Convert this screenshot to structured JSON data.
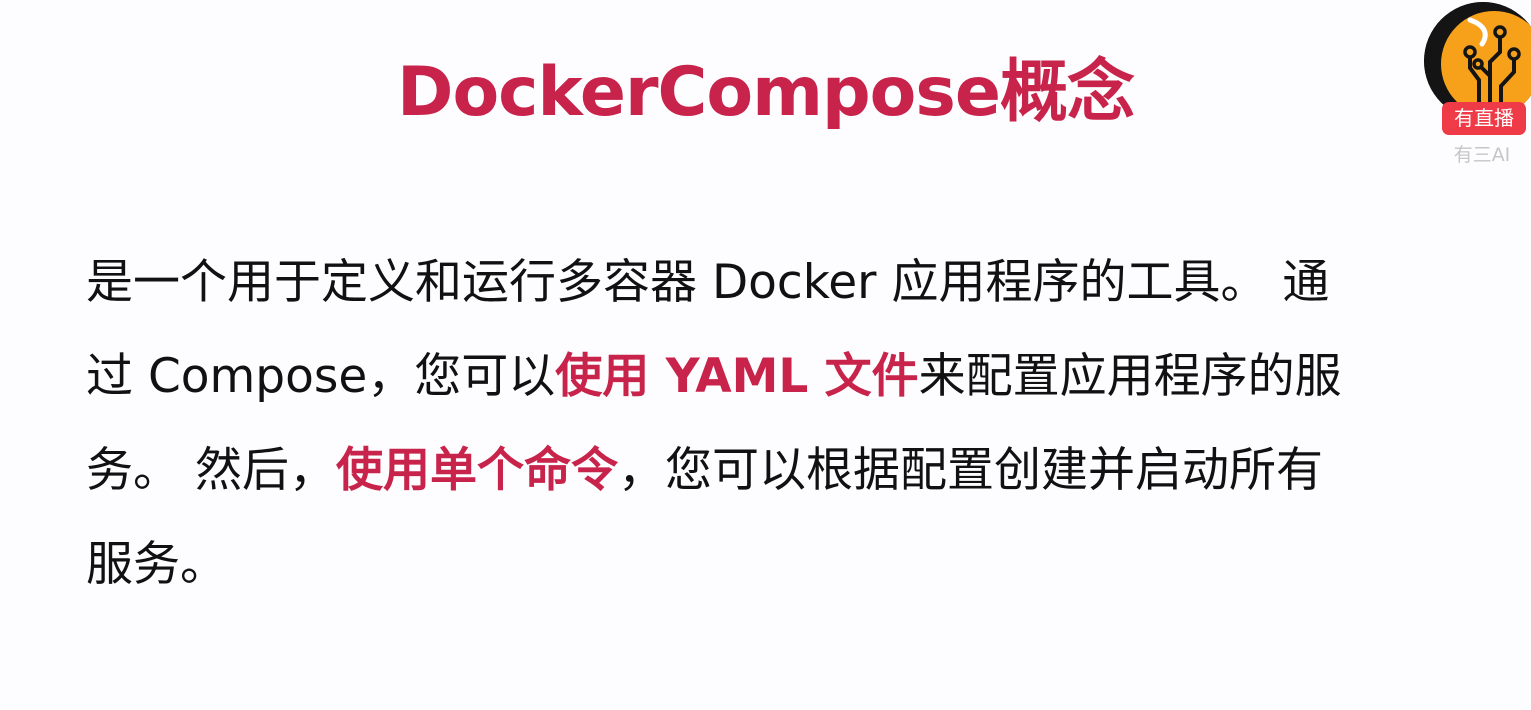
{
  "slide": {
    "title": "DockerCompose概念",
    "lines": [
      {
        "before": "是一个用于定义和运行多容器 Docker 应用程序的工具。 通",
        "highlight": "",
        "after": ""
      },
      {
        "before": "过 Compose，您可以",
        "highlight": "使用 YAML 文件",
        "after": "来配置应用程序的服"
      },
      {
        "before": "务。 然后，",
        "highlight": "使用单个命令",
        "after": "，您可以根据配置创建并启动所有"
      },
      {
        "before": "服务。",
        "highlight": "",
        "after": ""
      }
    ]
  },
  "overlay": {
    "live_label": "有直播",
    "channel_name": "有三AI",
    "avatar_icon": "circuit-logo-icon"
  },
  "colors": {
    "accent": "#c8234a",
    "body_text": "#111111",
    "live_badge": "#ee3b47",
    "avatar_orange": "#f7a11a"
  }
}
